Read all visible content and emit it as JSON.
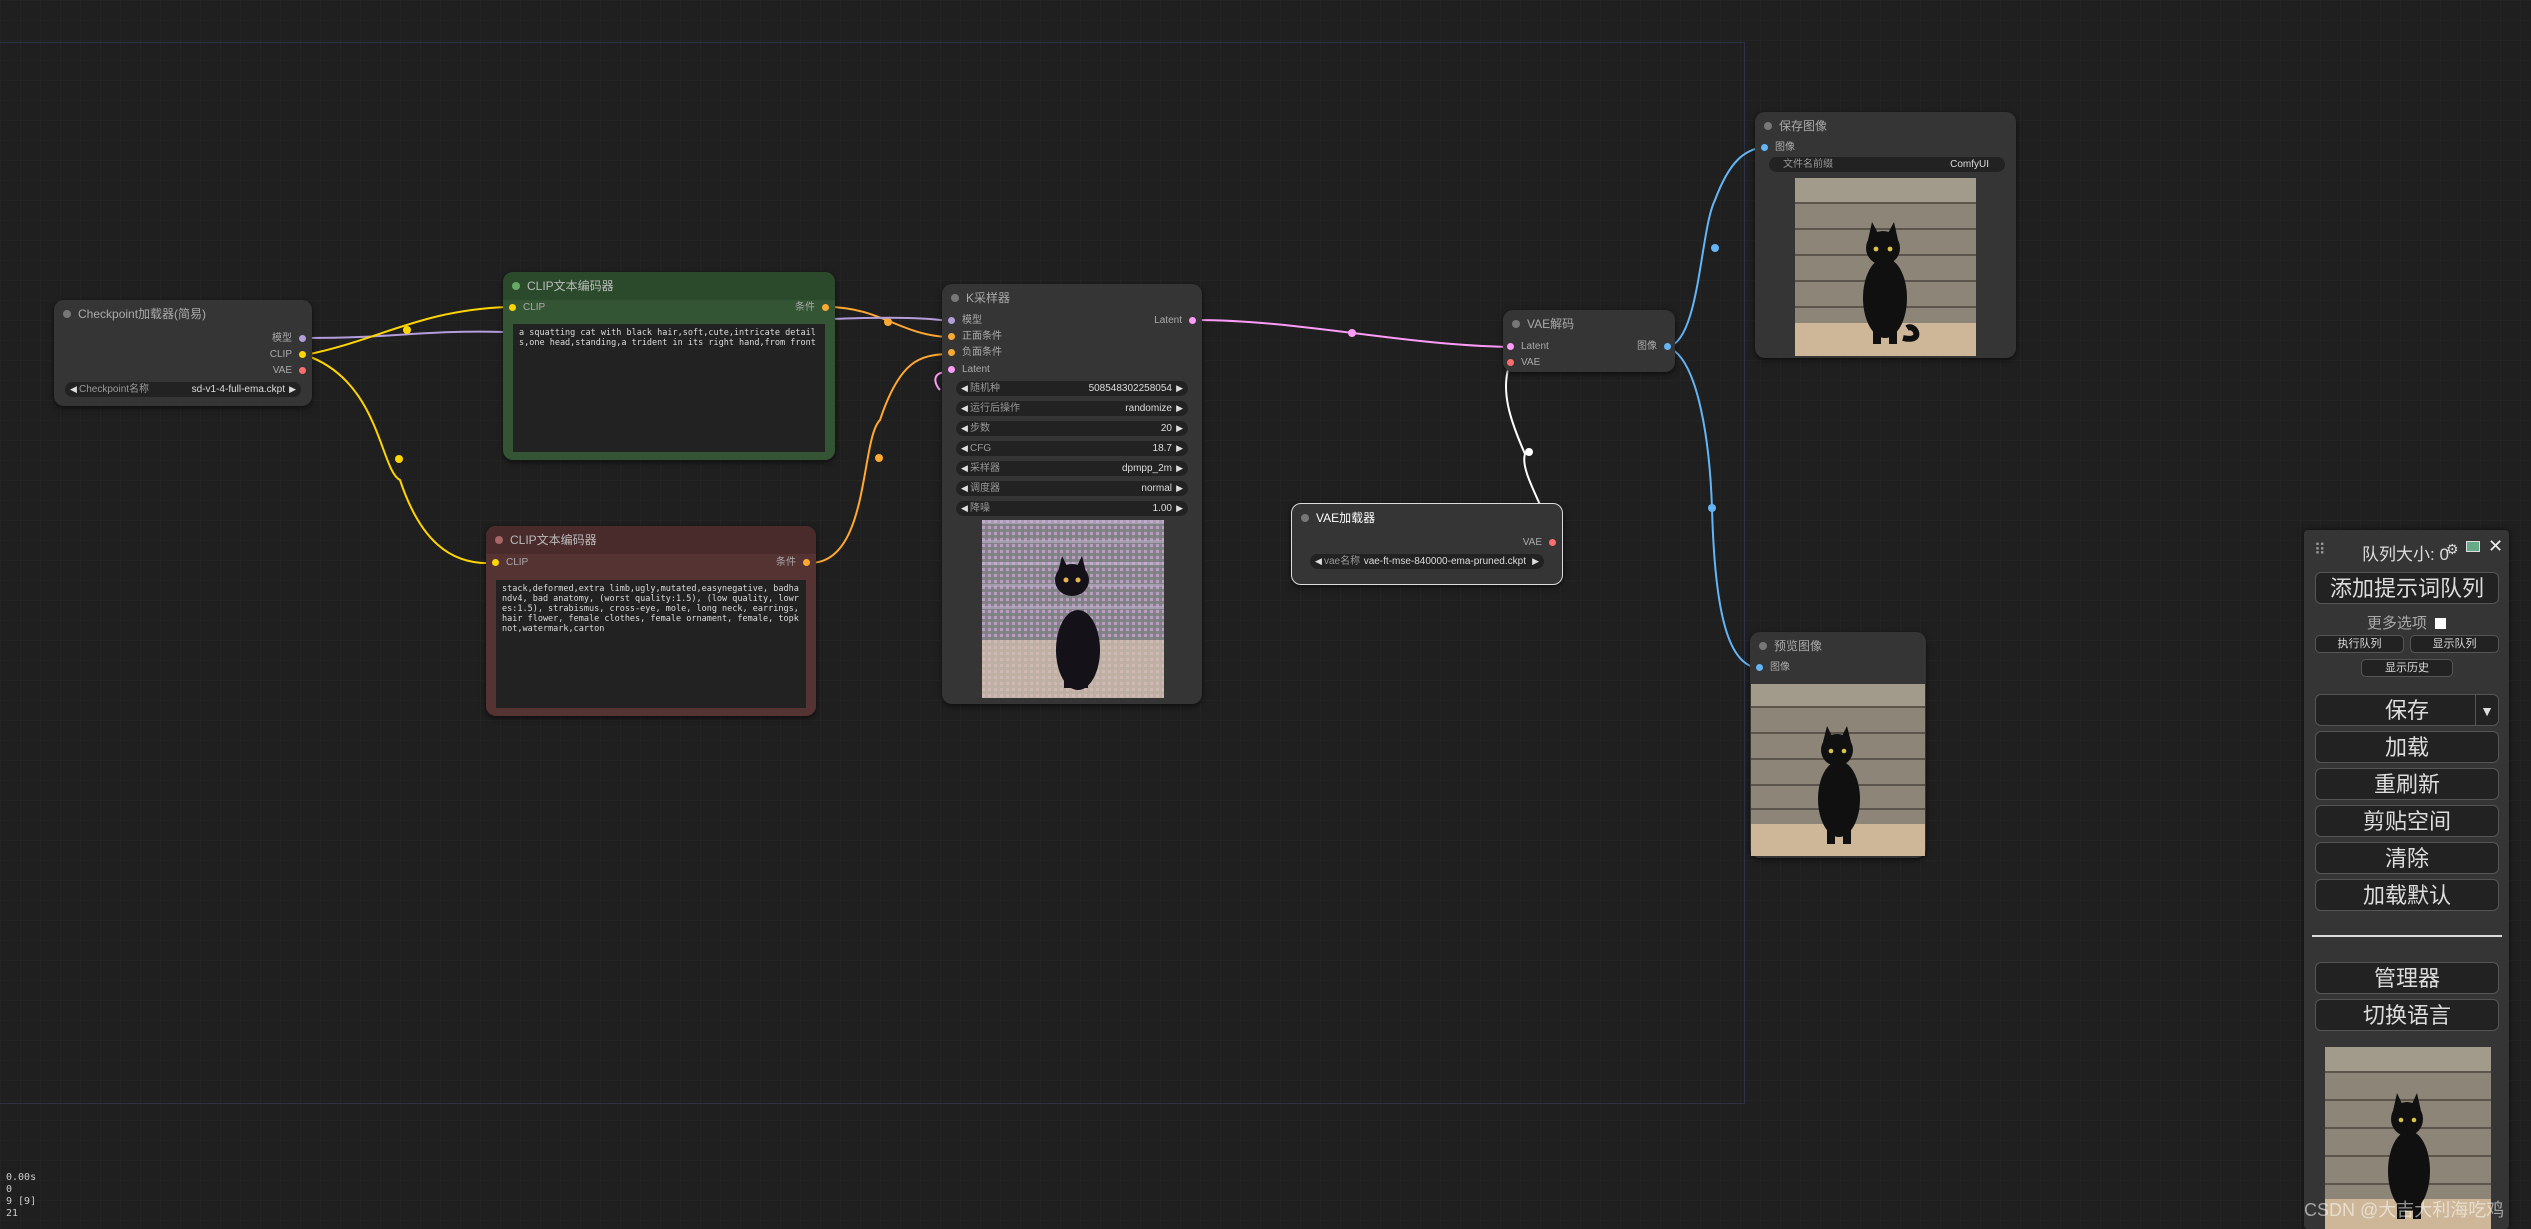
{
  "nodes": {
    "checkpoint": {
      "title": "Checkpoint加载器(简易)",
      "outputs": [
        "模型",
        "CLIP",
        "VAE"
      ],
      "widget_label": "Checkpoint名称",
      "widget_value": "sd-v1-4-full-ema.ckpt"
    },
    "clip_pos": {
      "title": "CLIP文本编码器",
      "input": "CLIP",
      "output": "条件",
      "text": "a squatting cat with black hair,soft,cute,intricate details,one head,standing,a trident in its right hand,from front"
    },
    "clip_neg": {
      "title": "CLIP文本编码器",
      "input": "CLIP",
      "output": "条件",
      "text": "stack,deformed,extra limb,ugly,mutated,easynegative, badhandv4, bad anatomy, (worst quality:1.5), (low quality, lowres:1.5), strabismus, cross-eye, mole, long neck, earrings, hair flower, female clothes, female ornament, female, topknot,watermark,carton"
    },
    "ksampler": {
      "title": "K采样器",
      "inputs": [
        "模型",
        "正面条件",
        "负面条件",
        "Latent"
      ],
      "output": "Latent",
      "widgets": [
        {
          "label": "随机种",
          "value": "508548302258054"
        },
        {
          "label": "运行后操作",
          "value": "randomize"
        },
        {
          "label": "步数",
          "value": "20"
        },
        {
          "label": "CFG",
          "value": "18.7"
        },
        {
          "label": "采样器",
          "value": "dpmpp_2m"
        },
        {
          "label": "调度器",
          "value": "normal"
        },
        {
          "label": "降噪",
          "value": "1.00"
        }
      ]
    },
    "vae_decode": {
      "title": "VAE解码",
      "inputs": [
        "Latent",
        "VAE"
      ],
      "output": "图像"
    },
    "vae_loader": {
      "title": "VAE加载器",
      "output": "VAE",
      "widget_label": "vae名称",
      "widget_value": "vae-ft-mse-840000-ema-pruned.ckpt"
    },
    "save_image": {
      "title": "保存图像",
      "input": "图像",
      "widget_label": "文件名前缀",
      "widget_value": "ComfyUI"
    },
    "preview_image": {
      "title": "预览图像",
      "input": "图像"
    }
  },
  "panel": {
    "queue_size": "队列大小: 0",
    "add_queue": "添加提示词队列",
    "more_options": "更多选项",
    "run_queue": "执行队列",
    "show_queue": "显示队列",
    "show_history": "显示历史",
    "save": "保存",
    "load": "加载",
    "refresh": "重刷新",
    "clipspace": "剪贴空间",
    "clear": "清除",
    "load_default": "加载默认",
    "manager": "管理器",
    "switch_lang": "切换语言"
  },
  "stats": [
    "0.00s",
    "0",
    "9 [9]",
    "21"
  ],
  "watermark": "CSDN @大吉大利海吃鸡",
  "colors": {
    "model": "#b39ddb",
    "clip": "#ffd500",
    "vae": "#ff6e6e",
    "latent": "#ff9cf9",
    "conditioning": "#ffa931",
    "image": "#64b5f6",
    "clip_pos_bg": "#335533",
    "clip_neg_bg": "#553333"
  }
}
